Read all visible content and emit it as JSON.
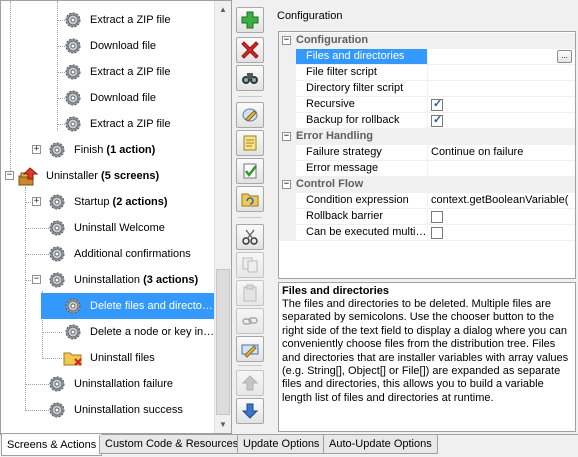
{
  "tree": {
    "items": [
      {
        "label": "Extract a ZIP file",
        "icon": "gear-icon"
      },
      {
        "label": "Download file",
        "icon": "gear-icon"
      },
      {
        "label": "Extract a ZIP file",
        "icon": "gear-icon"
      },
      {
        "label": "Download file",
        "icon": "gear-icon"
      },
      {
        "label": "Extract a ZIP file",
        "icon": "gear-icon"
      },
      {
        "label": "Finish",
        "bold": "(1 action)",
        "icon": "gear-icon"
      },
      {
        "label": "Uninstaller",
        "bold": "(5 screens)",
        "icon": "uninstaller-icon"
      },
      {
        "label": "Startup",
        "bold": "(2 actions)",
        "icon": "gear-icon"
      },
      {
        "label": "Uninstall Welcome",
        "icon": "gear-icon"
      },
      {
        "label": "Additional confirmations",
        "icon": "gear-icon"
      },
      {
        "label": "Uninstallation",
        "bold": "(3 actions)",
        "icon": "gear-icon"
      },
      {
        "label": "Delete files and directo…",
        "icon": "gear-icon"
      },
      {
        "label": "Delete a node or key in…",
        "icon": "gear-icon"
      },
      {
        "label": "Uninstall files",
        "icon": "folder-icon"
      },
      {
        "label": "Uninstallation failure",
        "icon": "gear-icon"
      },
      {
        "label": "Uninstallation success",
        "icon": "gear-icon"
      }
    ]
  },
  "toolbar": {
    "buttons": [
      "add-icon",
      "delete-icon",
      "binoculars-icon",
      "edit-icon",
      "notes-icon",
      "check-icon",
      "folder-refresh-icon",
      "cut-icon",
      "copy-icon",
      "paste-icon",
      "link-icon",
      "rename-icon",
      "move-up-icon",
      "move-down-icon"
    ]
  },
  "config": {
    "title": "Configuration",
    "categories": {
      "configuration": "Configuration",
      "error_handling": "Error Handling",
      "control_flow": "Control Flow"
    },
    "rows": {
      "files_dirs": {
        "name": "Files and directories",
        "value": "",
        "button": "..."
      },
      "file_filter": {
        "name": "File filter script",
        "value": ""
      },
      "dir_filter": {
        "name": "Directory filter script",
        "value": ""
      },
      "recursive": {
        "name": "Recursive",
        "checked": true
      },
      "backup": {
        "name": "Backup for rollback",
        "checked": true
      },
      "failure_strategy": {
        "name": "Failure strategy",
        "value": "Continue on failure"
      },
      "error_message": {
        "name": "Error message",
        "value": ""
      },
      "condition": {
        "name": "Condition expression",
        "value": "context.getBooleanVariable("
      },
      "rollback_barrier": {
        "name": "Rollback barrier",
        "checked": false
      },
      "multiple": {
        "name": "Can be executed multi…",
        "checked": false
      }
    },
    "description": {
      "title": "Files and directories",
      "body": "The files and directories to be deleted. Multiple files are separated by semicolons. Use the chooser button to the right side of the text field to display a dialog where you can conveniently choose files from the distribution tree. Files and directories that are installer variables with array values (e.g. String[], Object[] or File[]) are expanded as separate files and directories, this allows you to build a variable length list of files and directories at runtime."
    }
  },
  "tabs": [
    "Screens & Actions",
    "Custom Code & Resources",
    "Update Options",
    "Auto-Update Options"
  ],
  "colors": {
    "selection": "#3399ff",
    "add": "#2e9a2e",
    "delete": "#d42020",
    "arrow": "#3a78c8"
  }
}
